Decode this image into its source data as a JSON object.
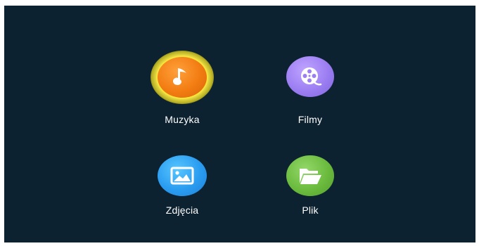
{
  "menu": {
    "items": [
      {
        "label": "Muzyka",
        "icon": "music-note-icon",
        "color": "#f27c12",
        "selected": true
      },
      {
        "label": "Filmy",
        "icon": "film-reel-icon",
        "color": "#9c7ef2",
        "selected": false
      },
      {
        "label": "Zdjęcia",
        "icon": "picture-icon",
        "color": "#2a9cf0",
        "selected": false
      },
      {
        "label": "Plik",
        "icon": "folder-icon",
        "color": "#6bbb3e",
        "selected": false
      }
    ]
  },
  "colors": {
    "background": "#0d2230",
    "selection_glow": "#f7e43a",
    "text": "#ffffff"
  }
}
